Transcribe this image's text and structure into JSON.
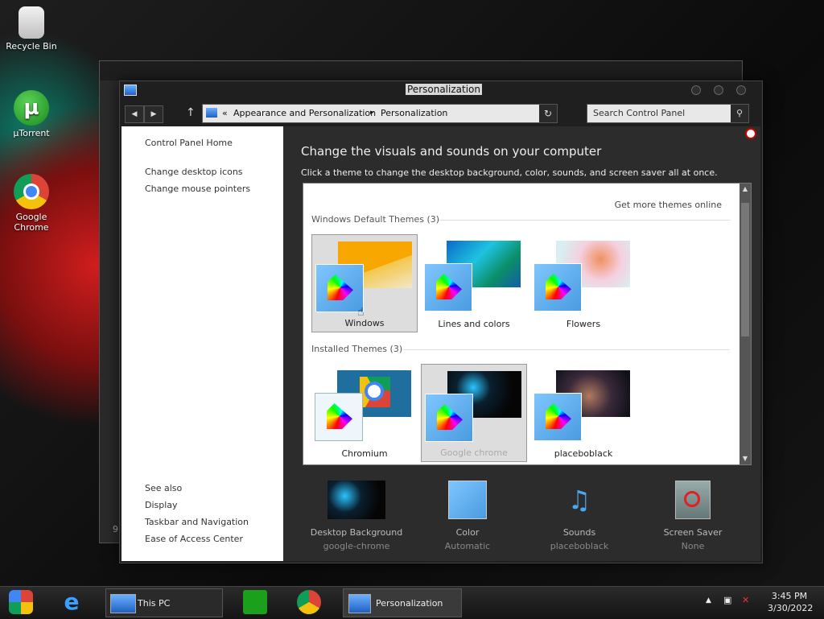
{
  "desktop": {
    "icons": [
      {
        "label": "Recycle Bin"
      },
      {
        "label": "µTorrent"
      },
      {
        "label": "Google\nChrome"
      }
    ],
    "back_window_fragment": "9"
  },
  "window": {
    "title": "Personalization",
    "breadcrumb": {
      "prefix": "«",
      "items": [
        "Appearance and Personalization",
        "Personalization"
      ],
      "separator": "▸"
    },
    "search_placeholder": "Search Control Panel",
    "left_nav": {
      "home": "Control Panel Home",
      "links": [
        "Change desktop icons",
        "Change mouse pointers"
      ],
      "see_also_title": "See also",
      "see_also": [
        "Display",
        "Taskbar and Navigation",
        "Ease of Access Center"
      ]
    },
    "heading": "Change the visuals and sounds on your computer",
    "subtext": "Click a theme to change the desktop background, color, sounds, and screen saver all at once.",
    "get_more": "Get more themes online",
    "groups": [
      {
        "title": "Windows Default Themes (3)",
        "themes": [
          "Windows",
          "Lines and colors",
          "Flowers"
        ]
      },
      {
        "title": "Installed Themes (3)",
        "themes": [
          "Chromium",
          "Google chrome",
          "placeboblack"
        ]
      }
    ],
    "bottom": [
      {
        "label": "Desktop Background",
        "value": "google-chrome"
      },
      {
        "label": "Color",
        "value": "Automatic"
      },
      {
        "label": "Sounds",
        "value": "placeboblack"
      },
      {
        "label": "Screen Saver",
        "value": "None"
      }
    ]
  },
  "taskbar": {
    "this_pc": "This PC",
    "personalization": "Personalization",
    "time": "3:45 PM",
    "date": "3/30/2022"
  },
  "colors": {
    "accent": "#4a9be0",
    "window_dark": "#1f1f1f",
    "content_dark": "#2c2c2c"
  }
}
